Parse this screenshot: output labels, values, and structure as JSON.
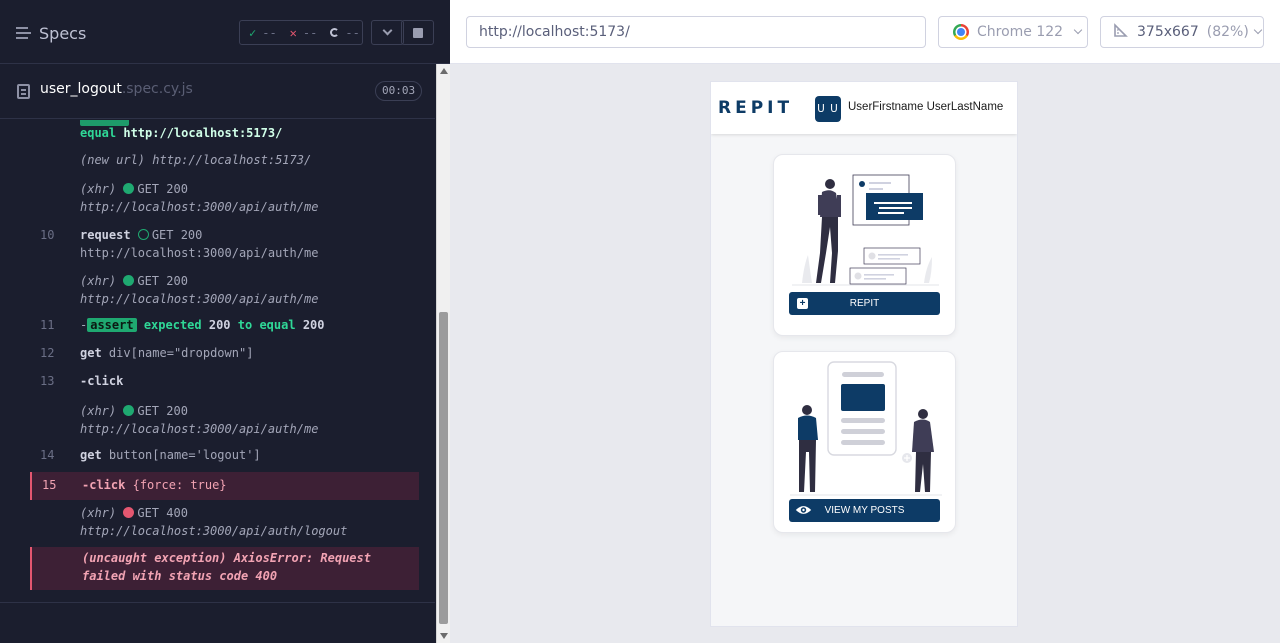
{
  "reporter": {
    "specs_label": "Specs",
    "stats": {
      "passed": "--",
      "failed": "--",
      "pending": "--"
    },
    "spec_file": {
      "name": "user_logout",
      "ext": ".spec.cy.js"
    },
    "duration": "00:03"
  },
  "commands": [
    {
      "kind": "partial",
      "text_a": "equal",
      "text_b": "http://localhost:5173/"
    },
    {
      "kind": "event",
      "label": "(new url)",
      "url": "http://localhost:5173/"
    },
    {
      "kind": "xhr",
      "label": "(xhr)",
      "status": "GET 200",
      "url": "http://localhost:3000/api/auth/me"
    },
    {
      "kind": "request",
      "number": "10",
      "method": "request",
      "status": "GET 200",
      "url": "http://localhost:3000/api/auth/me"
    },
    {
      "kind": "xhr",
      "label": "(xhr)",
      "status": "GET 200",
      "url": "http://localhost:3000/api/auth/me"
    },
    {
      "kind": "assert",
      "number": "11",
      "prefix": "-",
      "badge": "assert",
      "expected": "expected",
      "a": "200",
      "to_equal": "to equal",
      "b": "200"
    },
    {
      "kind": "get",
      "number": "12",
      "method": "get",
      "selector": "div[name=\"dropdown\"]"
    },
    {
      "kind": "click",
      "number": "13",
      "method": "-click"
    },
    {
      "kind": "xhr",
      "label": "(xhr)",
      "status": "GET 200",
      "url": "http://localhost:3000/api/auth/me"
    },
    {
      "kind": "get",
      "number": "14",
      "method": "get",
      "selector": "button[name='logout']"
    },
    {
      "kind": "click-failed",
      "number": "15",
      "method": "-click",
      "args": "{force: true}"
    },
    {
      "kind": "xhr-failed",
      "label": "(xhr)",
      "status": "GET 400",
      "url": "http://localhost:3000/api/auth/logout"
    },
    {
      "kind": "error",
      "line1": "(uncaught exception)  AxiosError: Request",
      "line2": "failed with status code 400"
    }
  ],
  "aut": {
    "url": "http://localhost:5173/",
    "browser": "Chrome 122",
    "viewport": "375x667",
    "scale": "(82%)"
  },
  "app": {
    "brand": "REPIT",
    "avatar_initials": "U U",
    "user_name": "UserFirstname UserLastName",
    "cards": [
      {
        "button": "REPIT",
        "icon": "plus-square-icon"
      },
      {
        "button": "VIEW MY POSTS",
        "icon": "eye-icon"
      }
    ]
  },
  "colors": {
    "reporter_bg": "#1b1e2e",
    "brand_navy": "#0d3b66",
    "passed_green": "#1fa971",
    "failed_red": "#e45770"
  }
}
